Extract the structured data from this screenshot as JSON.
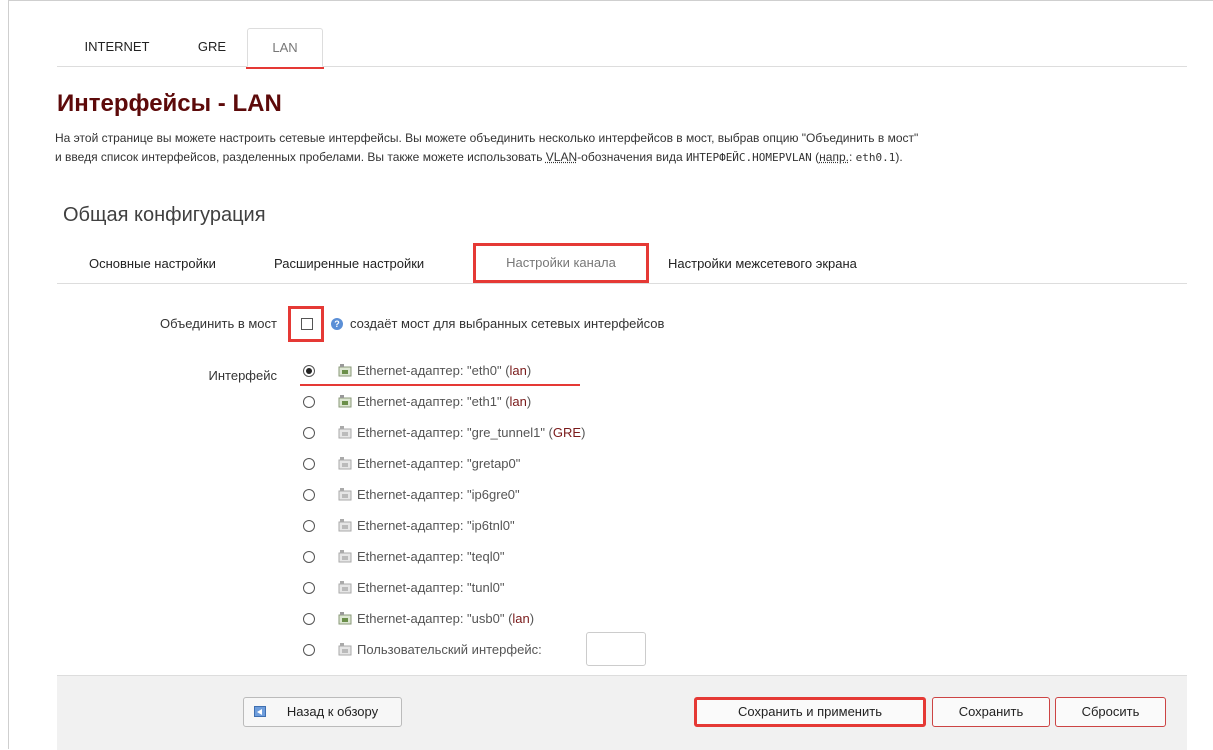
{
  "top_tabs": [
    "INTERNET",
    "GRE",
    "LAN"
  ],
  "page_title": "Интерфейсы - LAN",
  "description": {
    "line1": "На этой странице вы можете настроить сетевые интерфейсы. Вы можете объединить несколько интерфейсов в мост, выбрав опцию \"Объединить в мост\"",
    "line2_a": "и введя список интерфейсов, разделенных пробелами. Вы также можете использовать ",
    "abbr_vlan": "VLAN",
    "line2_b": "-обозначения вида ",
    "code_example": "ИНТЕРФЕЙС.НОМЕРVLAN",
    "line2_c": " (",
    "abbr_eg": "напр.",
    "line2_d": ": ",
    "code_eth": "eth0.1",
    "line2_e": ")."
  },
  "section_title": "Общая конфигурация",
  "sub_tabs": [
    "Основные настройки",
    "Расширенные настройки",
    "Настройки канала",
    "Настройки межсетевого экрана"
  ],
  "bridge": {
    "label": "Объединить в мост",
    "checked": false,
    "help": "создаёт мост для выбранных сетевых интерфейсов"
  },
  "interface": {
    "label": "Интерфейс",
    "options": [
      {
        "text": "Ethernet-адаптер: \"eth0\" (",
        "net": "lan",
        "close": ")",
        "selected": true
      },
      {
        "text": "Ethernet-адаптер: \"eth1\" (",
        "net": "lan",
        "close": ")",
        "selected": false
      },
      {
        "text": "Ethernet-адаптер: \"gre_tunnel1\" (",
        "net": "GRE",
        "close": ")",
        "selected": false
      },
      {
        "text": "Ethernet-адаптер: \"gretap0\"",
        "net": "",
        "close": "",
        "selected": false
      },
      {
        "text": "Ethernet-адаптер: \"ip6gre0\"",
        "net": "",
        "close": "",
        "selected": false
      },
      {
        "text": "Ethernet-адаптер: \"ip6tnl0\"",
        "net": "",
        "close": "",
        "selected": false
      },
      {
        "text": "Ethernet-адаптер: \"teql0\"",
        "net": "",
        "close": "",
        "selected": false
      },
      {
        "text": "Ethernet-адаптер: \"tunl0\"",
        "net": "",
        "close": "",
        "selected": false
      },
      {
        "text": "Ethernet-адаптер: \"usb0\" (",
        "net": "lan",
        "close": ")",
        "selected": false
      }
    ],
    "custom_label": "Пользовательский интерфейс:",
    "custom_value": ""
  },
  "footer": {
    "back": "Назад к обзору",
    "save_apply": "Сохранить и применить",
    "save": "Сохранить",
    "reset": "Сбросить"
  }
}
